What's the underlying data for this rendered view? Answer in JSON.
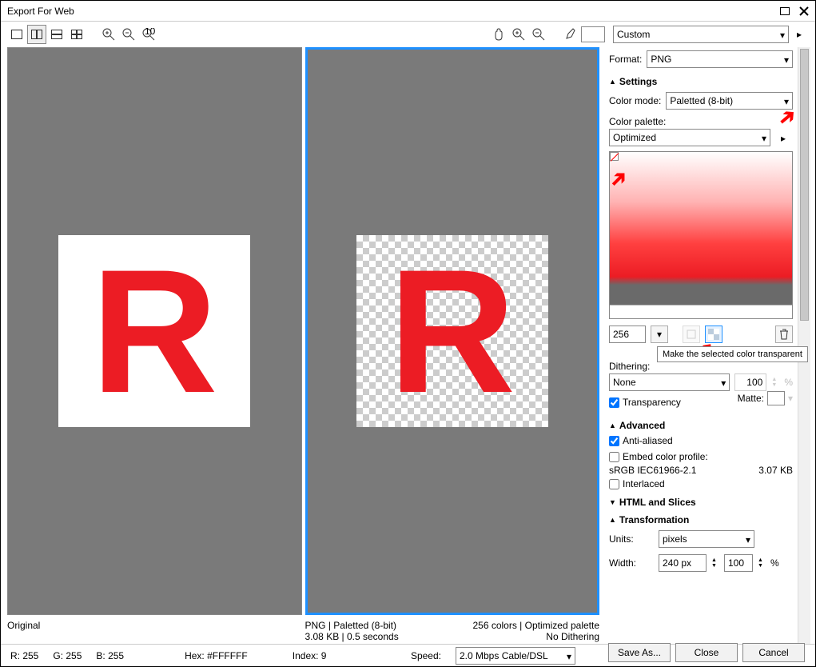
{
  "window": {
    "title": "Export For Web"
  },
  "preset": {
    "value": "Custom"
  },
  "format": {
    "label": "Format:",
    "value": "PNG"
  },
  "sections": {
    "settings": "Settings",
    "advanced": "Advanced",
    "html": "HTML and Slices",
    "transform": "Transformation"
  },
  "settings": {
    "color_mode_label": "Color mode:",
    "color_mode_value": "Paletted (8-bit)",
    "color_palette_label": "Color palette:",
    "color_palette_value": "Optimized",
    "colors_value": "256",
    "dithering_label": "Dithering:",
    "dithering_value": "None",
    "dither_amount": "100",
    "dither_unit": "%",
    "transparency_label": "Transparency",
    "matte_label": "Matte:"
  },
  "advanced": {
    "antialiased": "Anti-aliased",
    "embed": "Embed color profile:",
    "profile": "sRGB IEC61966-2.1",
    "profile_size": "3.07 KB",
    "interlaced": "Interlaced"
  },
  "transform": {
    "units_label": "Units:",
    "units_value": "pixels",
    "width_label": "Width:",
    "width_value": "240 px",
    "width_pct": "100",
    "pct": "%"
  },
  "preview": {
    "original_label": "Original",
    "opt_line1_left": "PNG  |  Paletted (8-bit)",
    "opt_line1_right": "256 colors  |  Optimized palette",
    "opt_line2_left": "3.08 KB  |  0.5 seconds",
    "opt_line2_right": "No Dithering"
  },
  "status": {
    "r": "R: 255",
    "g": "G: 255",
    "b": "B: 255",
    "hex": "Hex: #FFFFFF",
    "index": "Index: 9",
    "speed_label": "Speed:",
    "speed_value": "2.0 Mbps Cable/DSL"
  },
  "buttons": {
    "save": "Save As...",
    "close": "Close",
    "cancel": "Cancel"
  },
  "tooltip": "Make the selected color transparent"
}
